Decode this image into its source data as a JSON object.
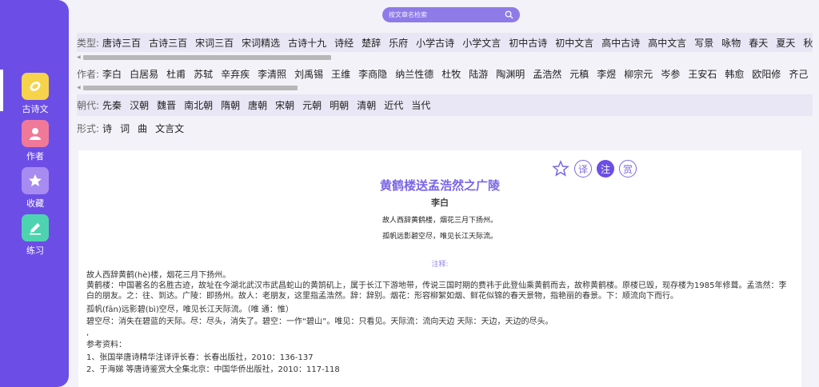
{
  "sidebar": {
    "items": [
      {
        "label": "古诗文",
        "icon": "lemon-icon",
        "color": "#f6d34a"
      },
      {
        "label": "作者",
        "icon": "person-icon",
        "color": "#f0799a"
      },
      {
        "label": "收藏",
        "icon": "star-icon",
        "color": "#a88bf0"
      },
      {
        "label": "练习",
        "icon": "pencil-icon",
        "color": "#4ed3b0"
      }
    ]
  },
  "search": {
    "placeholder": "按文章名检索"
  },
  "filters": {
    "type": {
      "label": "类型:",
      "items": [
        "唐诗三百",
        "古诗三百",
        "宋词三百",
        "宋词精选",
        "古诗十九",
        "诗经",
        "楚辞",
        "乐府",
        "小学古诗",
        "小学文言",
        "初中古诗",
        "初中文言",
        "高中古诗",
        "高中文言",
        "写景",
        "咏物",
        "春天",
        "夏天",
        "秋"
      ]
    },
    "author": {
      "label": "作者:",
      "items": [
        "李白",
        "白居易",
        "杜甫",
        "苏轼",
        "辛弃疾",
        "李清照",
        "刘禹锡",
        "王维",
        "李商隐",
        "纳兰性德",
        "杜牧",
        "陆游",
        "陶渊明",
        "孟浩然",
        "元稹",
        "李煜",
        "柳宗元",
        "岑参",
        "王安石",
        "韩愈",
        "欧阳修",
        "齐己"
      ]
    },
    "dynasty": {
      "label": "朝代:",
      "items": [
        "先秦",
        "汉朝",
        "魏晋",
        "南北朝",
        "隋朝",
        "唐朝",
        "宋朝",
        "元朝",
        "明朝",
        "清朝",
        "近代",
        "当代"
      ]
    },
    "form": {
      "label": "形式:",
      "items": [
        "诗",
        "词",
        "曲",
        "文言文"
      ]
    }
  },
  "poem": {
    "actions": [
      {
        "label": "",
        "icon": "star-outline-icon"
      },
      {
        "label": "译",
        "icon": ""
      },
      {
        "label": "注",
        "icon": ""
      },
      {
        "label": "赏",
        "icon": ""
      }
    ],
    "title": "黄鹤楼送孟浩然之广陵",
    "author": "李白",
    "lines": [
      "故人西辞黄鹤楼，烟花三月下扬州。",
      "孤帆远影碧空尽，唯见长江天际流。"
    ],
    "notes_heading": "注释:",
    "annotations": [
      {
        "text": "故人西辞黄鹤(hè)楼，烟花三月下扬州。",
        "style": "dark"
      },
      {
        "text": "黄鹤楼：中国著名的名胜古迹，故址在今湖北武汉市武昌蛇山的黄鹄矶上，属于长江下游地带，传说三国时期的费祎于此登仙乘黄鹤而去，故称黄鹤楼。原楼已毁，现存楼为1985年修葺。孟浩然：李白的朋友。之：往、到达。广陵：即扬州。故人：老朋友，这里指孟浩然。辞：辞别。烟花：形容柳絮如烟、鲜花似锦的春天景物，指艳丽的春景。下：顺流向下而行。",
        "style": "pur"
      },
      {
        "text": "孤帆(fān)远影碧(bì)空尽，唯见长江天际流。（唯 通：惟）",
        "style": "dark"
      },
      {
        "text": "碧空尽：消失在碧蓝的天际。尽：尽头，消失了。碧空：一作“碧山”。唯见：只看见。天际流：流向天边 天际：天边，天边的尽头。",
        "style": "pur"
      },
      {
        "text": ",",
        "style": "dark"
      },
      {
        "text": "参考资料：",
        "style": "dark"
      },
      {
        "text": "1、张国举唐诗精华注译评长春：长春出版社，2010：136-137",
        "style": "dark"
      },
      {
        "text": "2、于海娣 等唐诗鉴赏大全集北京：中国华侨出版社，2010：117-118",
        "style": "dark"
      }
    ]
  },
  "theme": {
    "accent": "#6c4ee6",
    "note_color": "#9a88ea"
  }
}
